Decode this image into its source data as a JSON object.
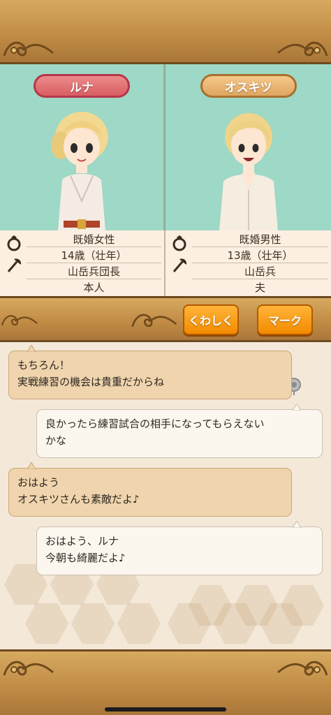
{
  "characters": {
    "left": {
      "name": "ルナ",
      "status": "既婚女性",
      "age": "14歳（壮年）",
      "job": "山岳兵団長",
      "relation": "本人"
    },
    "right": {
      "name": "オスキツ",
      "status": "既婚男性",
      "age": "13歳（壮年）",
      "job": "山岳兵",
      "relation": "夫"
    }
  },
  "actions": {
    "details_label": "くわしく",
    "mark_label": "マーク"
  },
  "messages": [
    {
      "side": "incoming",
      "lines": [
        "もちろん！",
        "実戦練習の機会は貴重だからね"
      ]
    },
    {
      "side": "outgoing",
      "lines": [
        "良かったら練習試合の相手になってもらえない",
        "かな"
      ]
    },
    {
      "side": "incoming",
      "lines": [
        "おはよう",
        "オスキツさんも素敵だよ♪"
      ]
    },
    {
      "side": "outgoing",
      "lines": [
        "おはよう、ルナ",
        "今朝も綺麗だよ♪"
      ]
    }
  ],
  "colors": {
    "panel_bg": "#9ed8c6",
    "accent_orange": "#f28a00",
    "female_pill": "#d95e62",
    "male_pill": "#dfa660",
    "frame_bronze": "#c99750"
  },
  "icons": [
    "ring-icon",
    "axe-icon",
    "ornament-scroll-icon",
    "pin-icon"
  ]
}
